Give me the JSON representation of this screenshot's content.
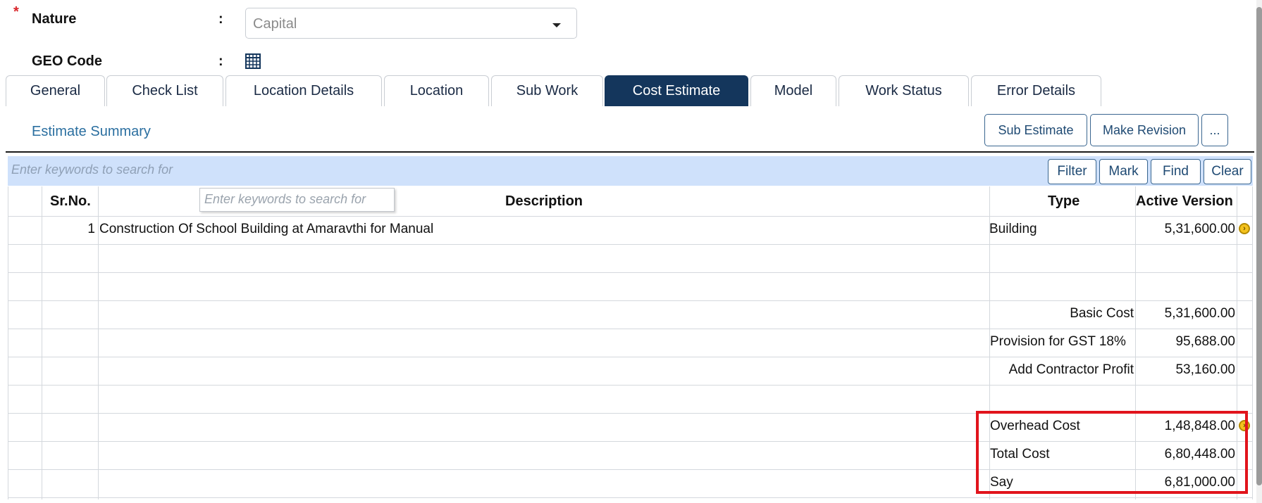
{
  "form": {
    "required_mark": "*",
    "nature_label": "Nature",
    "colon": ":",
    "nature_value": "Capital",
    "geo_label": "GEO Code"
  },
  "tabs": [
    {
      "label": "General"
    },
    {
      "label": "Check List"
    },
    {
      "label": "Location Details"
    },
    {
      "label": "Location"
    },
    {
      "label": "Sub Work"
    },
    {
      "label": "Cost Estimate",
      "active": true
    },
    {
      "label": "Model"
    },
    {
      "label": "Work Status"
    },
    {
      "label": "Error Details"
    }
  ],
  "toolbar": {
    "summary_link": "Estimate Summary",
    "sub_estimate": "Sub Estimate",
    "make_revision": "Make Revision",
    "more": "..."
  },
  "search": {
    "placeholder": "Enter keywords to search for",
    "filter": "Filter",
    "mark": "Mark",
    "find": "Find",
    "clear": "Clear"
  },
  "grid": {
    "header_search_placeholder": "Enter keywords to search for",
    "headers": {
      "srno": "Sr.No.",
      "description": "Description",
      "type": "Type",
      "active_version": "Active Version"
    },
    "row1": {
      "srno": "1",
      "description": "Construction Of School Building at Amaravthi for Manual",
      "type": "Building",
      "amount": "5,31,600.00"
    },
    "summary": {
      "basic_cost_label": "Basic Cost",
      "basic_cost": "5,31,600.00",
      "gst_label": "Provision for GST 18%",
      "gst": "95,688.00",
      "profit_label": "Add Contractor Profit",
      "profit": "53,160.00",
      "overhead_label": "Overhead Cost",
      "overhead": "1,48,848.00",
      "total_label": "Total Cost",
      "total": "6,80,448.00",
      "say_label": "Say",
      "say": "6,81,000.00"
    }
  },
  "colors": {
    "active_tab": "#14365c",
    "link": "#2b6fa0",
    "search_band": "#cfe1fb",
    "highlight": "#e1141c",
    "required": "#d9262b"
  },
  "icons": [
    "grid-icon",
    "caret-down-icon",
    "arrow-right-circle-icon"
  ]
}
